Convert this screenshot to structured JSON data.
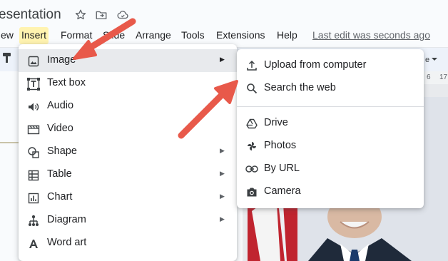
{
  "app": {
    "doc_title": "esentation",
    "last_edit": "Last edit was seconds ago"
  },
  "title_icons": [
    "star-icon",
    "folder-move-icon",
    "cloud-done-icon"
  ],
  "menubar": {
    "items": [
      "ew",
      "Insert",
      "Format",
      "Slide",
      "Arrange",
      "Tools",
      "Extensions",
      "Help"
    ],
    "active": "Insert"
  },
  "ruler": {
    "visible_marks": [
      "6",
      "17"
    ]
  },
  "insert_menu": {
    "items": [
      {
        "label": "Image",
        "icon": "image-icon",
        "has_submenu": true,
        "highlighted": true
      },
      {
        "label": "Text box",
        "icon": "text-box-icon",
        "has_submenu": false
      },
      {
        "label": "Audio",
        "icon": "audio-icon",
        "has_submenu": false
      },
      {
        "label": "Video",
        "icon": "video-icon",
        "has_submenu": false
      },
      {
        "label": "Shape",
        "icon": "shape-icon",
        "has_submenu": true
      },
      {
        "label": "Table",
        "icon": "table-icon",
        "has_submenu": true
      },
      {
        "label": "Chart",
        "icon": "chart-icon",
        "has_submenu": true
      },
      {
        "label": "Diagram",
        "icon": "diagram-icon",
        "has_submenu": true
      },
      {
        "label": "Word art",
        "icon": "word-art-icon",
        "has_submenu": false
      }
    ]
  },
  "image_submenu": {
    "items": [
      {
        "label": "Upload from computer",
        "icon": "upload-icon"
      },
      {
        "label": "Search the web",
        "icon": "search-icon"
      },
      {
        "label": "Drive",
        "icon": "drive-icon"
      },
      {
        "label": "Photos",
        "icon": "photos-icon"
      },
      {
        "label": "By URL",
        "icon": "link-icon"
      },
      {
        "label": "Camera",
        "icon": "camera-icon"
      }
    ]
  },
  "annotations": {
    "arrow_color": "#e8594a",
    "arrows": [
      "arrow-to-image-item",
      "arrow-to-search-the-web"
    ]
  },
  "colors": {
    "active_menu_bg": "#fff3b0",
    "highlight_row_bg": "#e8eaed",
    "toolbar_bg": "#edf2fa"
  }
}
